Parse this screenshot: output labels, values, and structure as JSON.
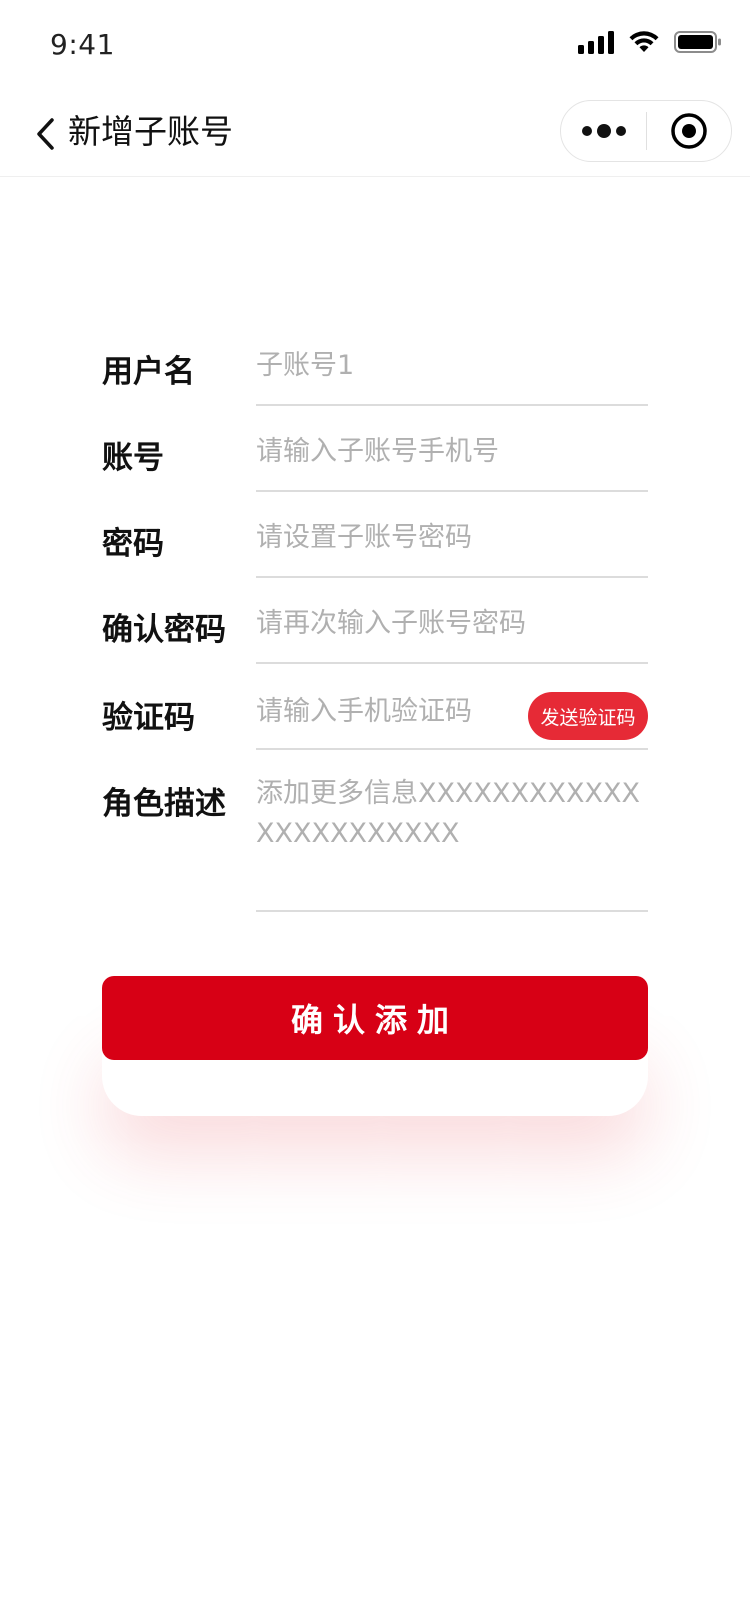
{
  "status_bar": {
    "time": "9:41"
  },
  "nav": {
    "title": "新增子账号"
  },
  "form": {
    "username": {
      "label": "用户名",
      "placeholder": "子账号1"
    },
    "account": {
      "label": "账号",
      "placeholder": "请输入子账号手机号"
    },
    "password": {
      "label": "密码",
      "placeholder": "请设置子账号密码"
    },
    "confirm_password": {
      "label": "确认密码",
      "placeholder": "请再次输入子账号密码"
    },
    "verification_code": {
      "label": "验证码",
      "placeholder": "请输入手机验证码",
      "send_button": "发送验证码"
    },
    "role_description": {
      "label": "角色描述",
      "placeholder": "添加更多信息XXXXXXXXXXXXXXXXXXXXXXX"
    }
  },
  "submit": {
    "label": "确认添加"
  },
  "colors": {
    "accent": "#d70015",
    "code_button": "#e62a36",
    "placeholder": "#b0b0b0"
  }
}
